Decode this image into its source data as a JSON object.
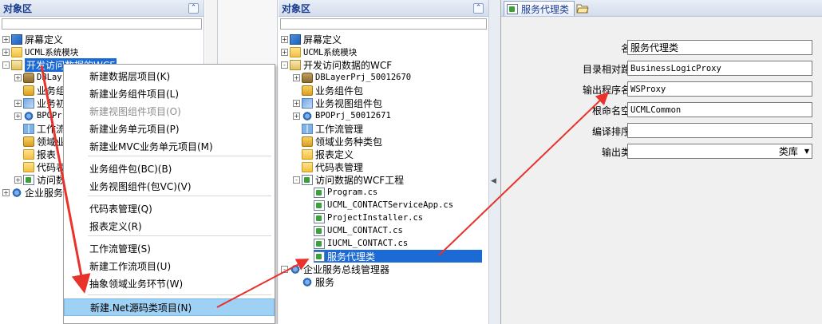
{
  "left_panel": {
    "title": "对象区",
    "collapse_glyph": "⌃",
    "tree": [
      {
        "label": "屏幕定义",
        "icon": "screen-icon",
        "expander": "+"
      },
      {
        "label": "UCML系统模块",
        "icon": "folder-icon",
        "expander": "+"
      },
      {
        "label": "开发访问数据的WCF",
        "icon": "project-icon",
        "expander": "-"
      },
      {
        "label": "DBLay",
        "icon": "database-icon",
        "expander": "+"
      },
      {
        "label": "业务组",
        "icon": "package-icon",
        "expander": ""
      },
      {
        "label": "业务初",
        "icon": "cube-icon",
        "expander": "+"
      },
      {
        "label": "BPOPr",
        "icon": "gear-icon",
        "expander": "+"
      },
      {
        "label": "工作流",
        "icon": "flow-icon",
        "expander": ""
      },
      {
        "label": "领域业",
        "icon": "package-icon",
        "expander": ""
      },
      {
        "label": "报表",
        "icon": "folder-icon",
        "expander": ""
      },
      {
        "label": "代码表",
        "icon": "folder-icon",
        "expander": ""
      },
      {
        "label": "访问数",
        "icon": "cs-icon",
        "expander": "+"
      },
      {
        "label": "企业服务",
        "icon": "gear-icon",
        "expander": "+"
      }
    ]
  },
  "context_menu": {
    "items": [
      {
        "label": "新建数据层项目(K)",
        "disabled": false
      },
      {
        "label": "新建业务组件项目(L)",
        "disabled": false
      },
      {
        "label": "新建视图组件项目(O)",
        "disabled": true
      },
      {
        "label": "新建业务单元项目(P)",
        "disabled": false
      },
      {
        "label": "新建业MVC业务单元项目(M)",
        "disabled": false
      },
      {
        "label": "业务组件包(BC)(B)",
        "disabled": false
      },
      {
        "label": "业务视图组件(包VC)(V)",
        "disabled": false
      },
      {
        "label": "代码表管理(Q)",
        "disabled": false
      },
      {
        "label": "报表定义(R)",
        "disabled": false
      },
      {
        "label": "工作流管理(S)",
        "disabled": false
      },
      {
        "label": "新建工作流项目(U)",
        "disabled": false
      },
      {
        "label": "抽象领域业务环节(W)",
        "disabled": false
      },
      {
        "label": "新建.Net源码类项目(N)",
        "disabled": false,
        "highlighted": true
      }
    ]
  },
  "middle_panel": {
    "title": "对象区",
    "collapse_glyph": "⌃",
    "tree": [
      {
        "label": "屏幕定义",
        "icon": "screen-icon",
        "expander": "+"
      },
      {
        "label": "UCML系统模块",
        "icon": "folder-icon",
        "expander": "+"
      },
      {
        "label": "开发访问数据的WCF",
        "icon": "project-icon",
        "expander": "-"
      },
      {
        "label": "DBLayerPrj_50012670",
        "icon": "database-icon",
        "expander": "+"
      },
      {
        "label": "业务组件包",
        "icon": "package-icon",
        "expander": ""
      },
      {
        "label": "业务视图组件包",
        "icon": "cube-icon",
        "expander": "+"
      },
      {
        "label": "BPOPrj_50012671",
        "icon": "gear-icon",
        "expander": "+"
      },
      {
        "label": "工作流管理",
        "icon": "flow-icon",
        "expander": ""
      },
      {
        "label": "领域业务种类包",
        "icon": "package-icon",
        "expander": ""
      },
      {
        "label": "报表定义",
        "icon": "folder-icon",
        "expander": ""
      },
      {
        "label": "代码表管理",
        "icon": "folder-icon",
        "expander": ""
      },
      {
        "label": "访问数据的WCF工程",
        "icon": "cs-icon",
        "expander": "-"
      },
      {
        "label": "Program.cs",
        "icon": "cs-icon",
        "expander": ""
      },
      {
        "label": "UCML_CONTACTServiceApp.cs",
        "icon": "cs-icon",
        "expander": ""
      },
      {
        "label": "ProjectInstaller.cs",
        "icon": "cs-icon",
        "expander": ""
      },
      {
        "label": "UCML_CONTACT.cs",
        "icon": "cs-icon",
        "expander": ""
      },
      {
        "label": "IUCML_CONTACT.cs",
        "icon": "cs-icon",
        "expander": ""
      },
      {
        "label": "服务代理类",
        "icon": "cs-icon",
        "expander": "",
        "selected": true
      },
      {
        "label": "企业服务总线管理器",
        "icon": "gear-icon",
        "expander": "-"
      },
      {
        "label": "服务",
        "icon": "gear-icon",
        "expander": ""
      }
    ]
  },
  "property_panel": {
    "tabs": [
      {
        "label": "服务代理类"
      }
    ],
    "fields": [
      {
        "label": "名称",
        "value": "服务代理类"
      },
      {
        "label": "目录相对路径",
        "value": "BusinessLogicProxy"
      },
      {
        "label": "输出程序名称",
        "value": "WSProxy"
      },
      {
        "label": "根命名空间",
        "value": "UCMLCommon"
      },
      {
        "label": "编译排序号",
        "value": ""
      },
      {
        "label": "输出类型",
        "value": "类库",
        "dropdown": true
      }
    ]
  },
  "colors": {
    "selection": "#1c6ad6",
    "menu_highlight": "#9fd1f5",
    "arrow": "#e8322b"
  }
}
